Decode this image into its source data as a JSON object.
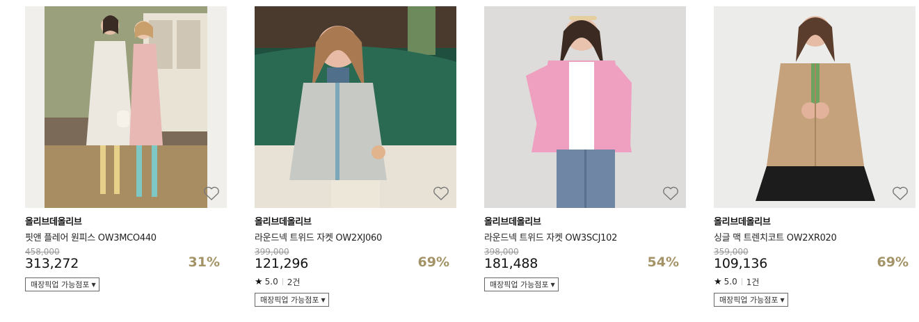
{
  "products": [
    {
      "brand": "올리브데올리브",
      "name": "핏앤 플레어 원피스 OW3MCO440",
      "original_price": "458,000",
      "sale_price": "313,272",
      "discount": "31%",
      "rating": null,
      "review_count": null,
      "pickup_label": "매장픽업 가능점포",
      "icon": "heart-outline-icon"
    },
    {
      "brand": "올리브데올리브",
      "name": "라운드넥 트위드 자켓 OW2XJ060",
      "original_price": "399,000",
      "sale_price": "121,296",
      "discount": "69%",
      "rating": "5.0",
      "review_count": "2건",
      "pickup_label": "매장픽업 가능점포",
      "icon": "heart-outline-icon"
    },
    {
      "brand": "올리브데올리브",
      "name": "라운드넥 트위드 자켓 OW3SCJ102",
      "original_price": "398,000",
      "sale_price": "181,488",
      "discount": "54%",
      "rating": null,
      "review_count": null,
      "pickup_label": "매장픽업 가능점포",
      "icon": "heart-outline-icon"
    },
    {
      "brand": "올리브데올리브",
      "name": "싱글 맥 트렌치코트 OW2XR020",
      "original_price": "359,000",
      "sale_price": "109,136",
      "discount": "69%",
      "rating": "5.0",
      "review_count": "1건",
      "pickup_label": "매장픽업 가능점포",
      "icon": "heart-outline-icon"
    }
  ],
  "colors": {
    "discount": "#a39366",
    "strike_price": "#999999"
  }
}
